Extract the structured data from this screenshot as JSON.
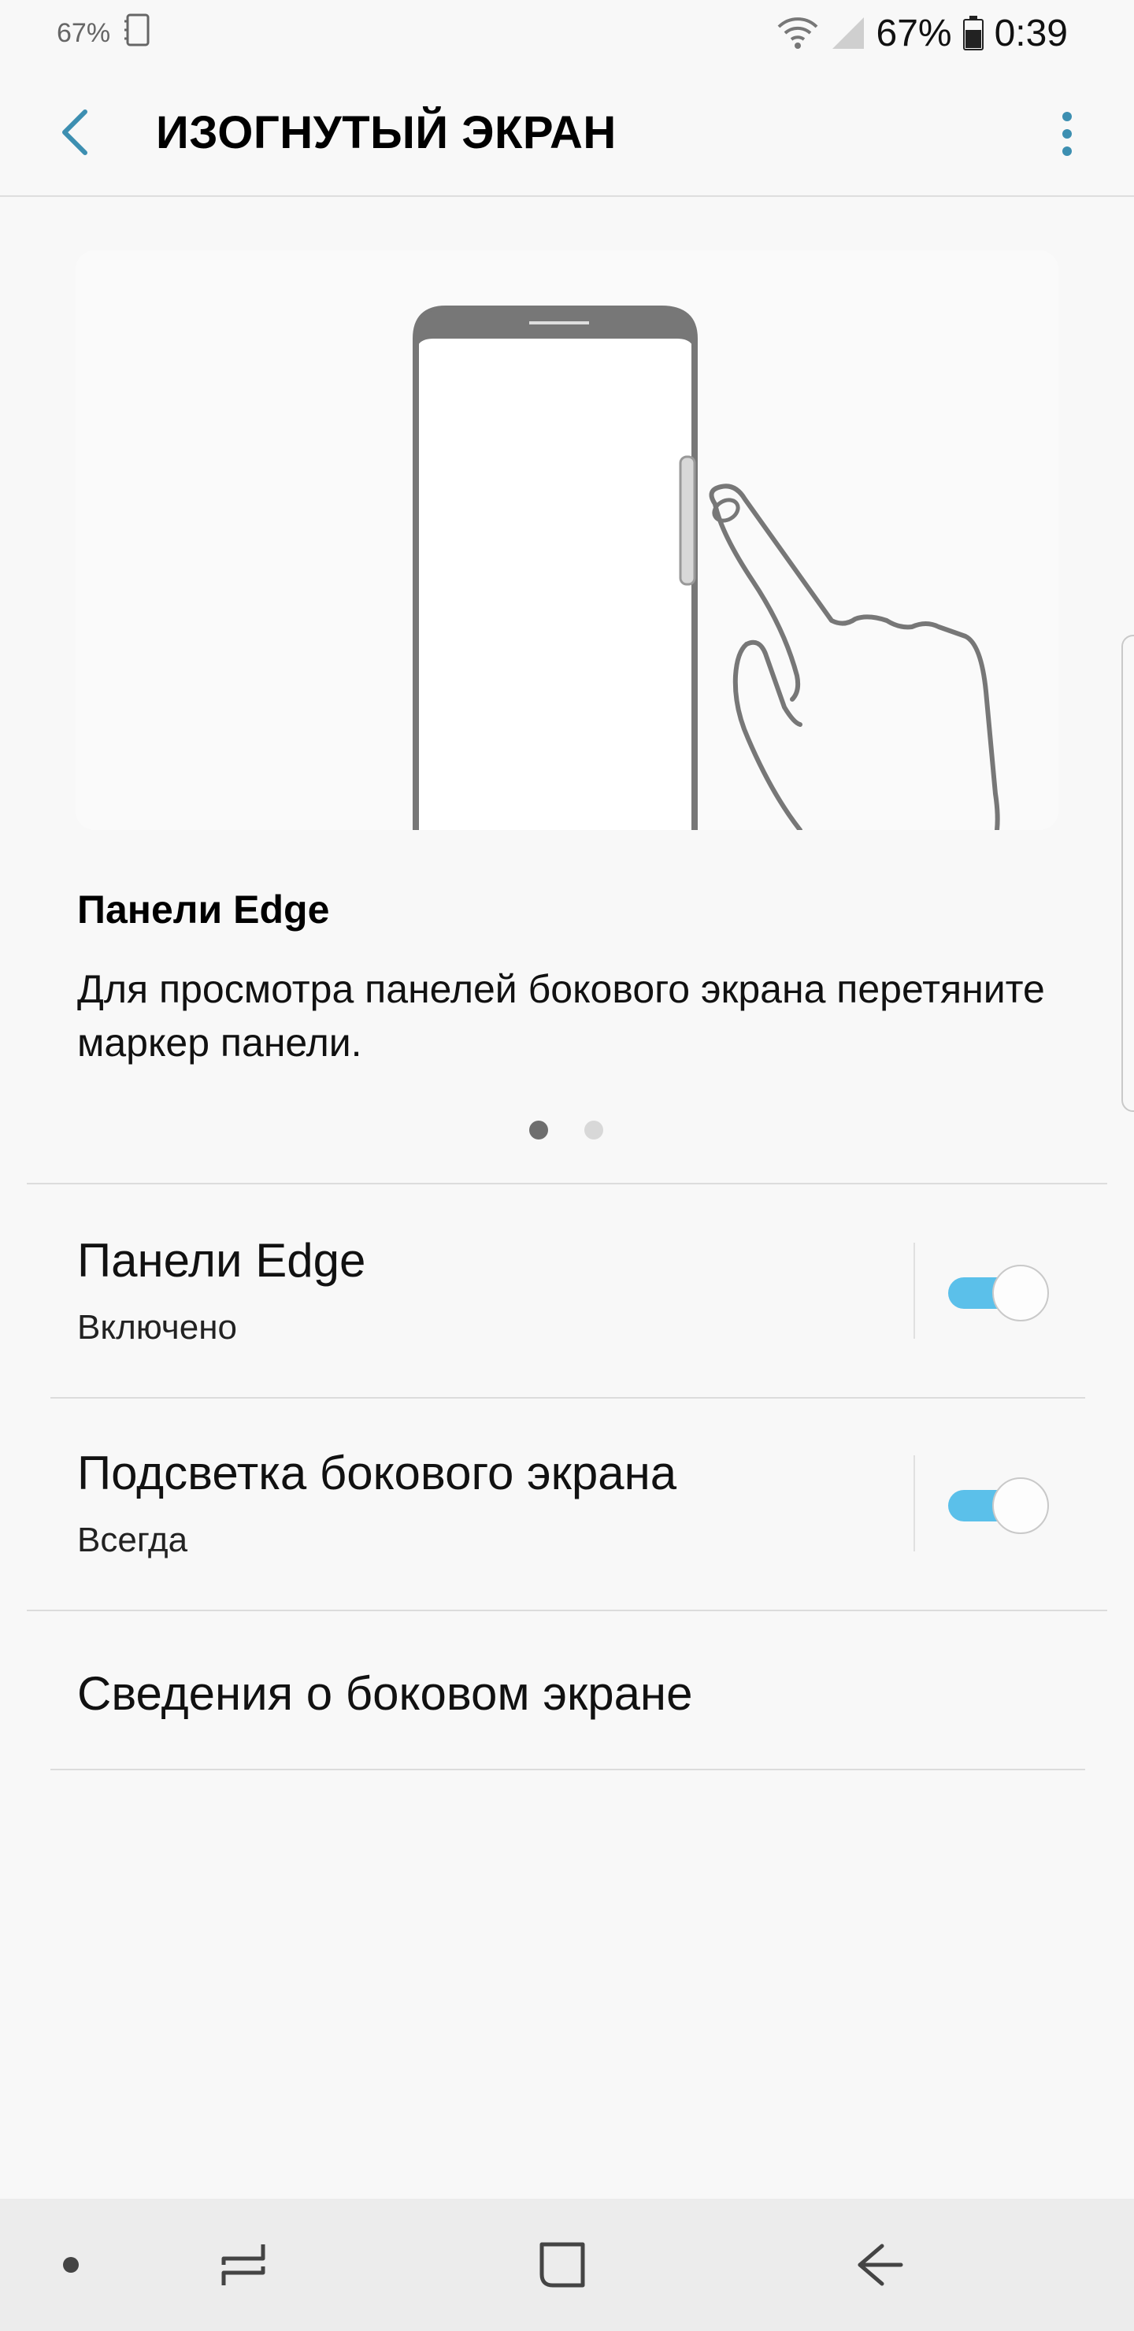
{
  "status_bar": {
    "left_small_pct": "67%",
    "battery_percent": "67%",
    "time": "0:39",
    "icons": [
      "battery-small-indicator",
      "notebook-icon",
      "wifi-icon",
      "signal-icon",
      "battery-icon"
    ]
  },
  "action_bar": {
    "title": "ИЗОГНУТЫЙ ЭКРАН",
    "back_icon": "chevron-left-icon",
    "more_icon": "more-vertical-icon",
    "accent_color": "#3d8fb1"
  },
  "card": {
    "title": "Панели Edge",
    "description": "Для просмотра панелей бокового экрана перетяните маркер панели.",
    "page_count": 2,
    "current_page": 1
  },
  "settings": [
    {
      "title": "Панели Edge",
      "subtitle": "Включено",
      "toggle_on": true
    },
    {
      "title": "Подсветка бокового экрана",
      "subtitle": "Всегда",
      "toggle_on": true
    },
    {
      "title": "Сведения о боковом экране"
    }
  ],
  "colors": {
    "toggle_on": "#5bc0ea",
    "background": "#f8f8f8",
    "nav_bar": "#ececec"
  },
  "nav_bar": {
    "icons": [
      "dot-icon",
      "recent-apps-icon",
      "home-icon",
      "back-arrow-icon"
    ]
  }
}
